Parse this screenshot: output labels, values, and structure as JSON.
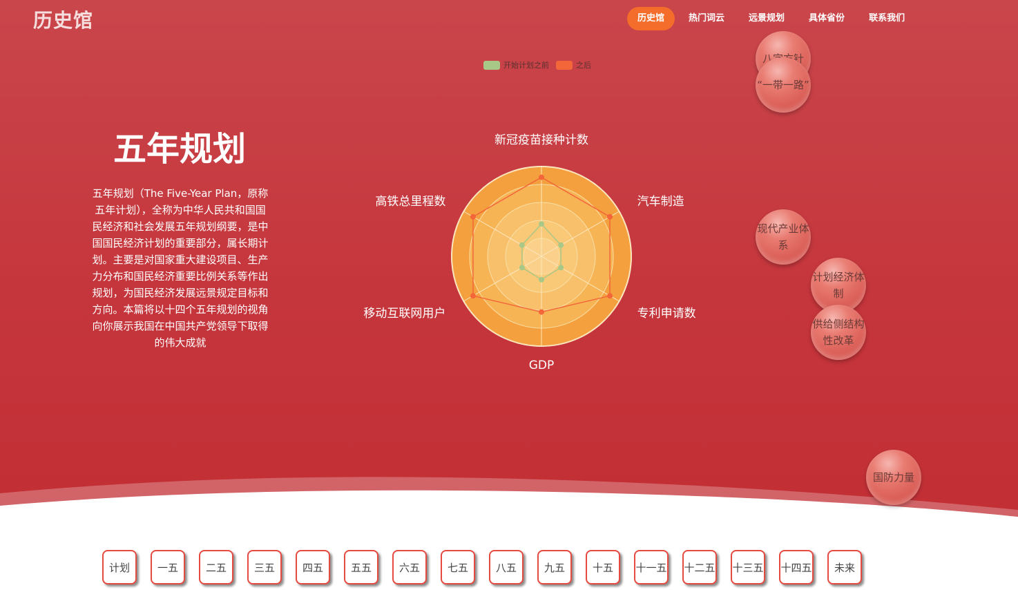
{
  "logo": "历史馆",
  "nav": [
    "历史馆",
    "热门词云",
    "远景规划",
    "具体省份",
    "联系我们"
  ],
  "hero": {
    "title": "五年规划",
    "description": "五年规划（The Five-Year Plan，原称五年计划），全称为中华人民共和国国民经济和社会发展五年规划纲要，是中国国民经济计划的重要部分，属长期计划。主要是对国家重大建设项目、生产力分布和国民经济重要比例关系等作出规划，为国民经济发展远景规定目标和方向。本篇将以十四个五年规划的视角向你展示我国在中国共产党领导下取得的伟大成就"
  },
  "chart_data": {
    "type": "radar",
    "indicators": [
      "新冠疫苗接种计数",
      "汽车制造",
      "专利申请数",
      "GDP",
      "移动互联网用户",
      "高铁总里程数"
    ],
    "series": [
      {
        "name": "开始计划之前",
        "color": "#a8c888",
        "values": [
          0.36,
          0.25,
          0.25,
          0.26,
          0.25,
          0.25
        ]
      },
      {
        "name": "之后",
        "color": "#f2663a",
        "values": [
          0.88,
          0.88,
          0.88,
          0.62,
          0.88,
          0.88
        ]
      }
    ],
    "max": 1
  },
  "bubbles": [
    "八字方针",
    "“一带一路”",
    "现代产业体系",
    "计划经济体制",
    "供给侧结构性改革",
    "国防力量"
  ],
  "timeline": [
    "计划",
    "一五",
    "二五",
    "三五",
    "四五",
    "五五",
    "六五",
    "七五",
    "八五",
    "九五",
    "十五",
    "十一五",
    "十二五",
    "十三五",
    "十四五",
    "未来"
  ]
}
